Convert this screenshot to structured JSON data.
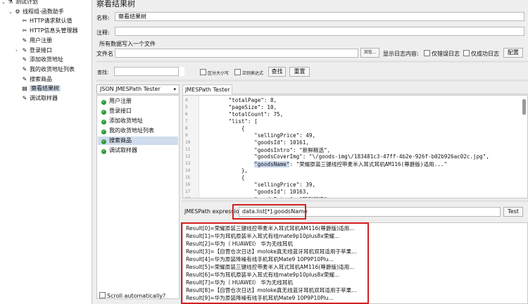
{
  "tree": {
    "items": [
      {
        "label": "测试计划",
        "icon": "⚗",
        "indent": 0,
        "arrow": "⌄"
      },
      {
        "label": "线程组-函数助手",
        "icon": "⚙",
        "indent": 1,
        "arrow": "⌄"
      },
      {
        "label": "HTTP请求默认值",
        "icon": "✂",
        "indent": 2,
        "arrow": ""
      },
      {
        "label": "HTTP信息头管理器",
        "icon": "✂",
        "indent": 2,
        "arrow": ""
      },
      {
        "label": "用户注册",
        "icon": "✎",
        "indent": 2,
        "arrow": ""
      },
      {
        "label": "登录接口",
        "icon": "✎",
        "indent": 2,
        "arrow": "›"
      },
      {
        "label": "添加收货地址",
        "icon": "✎",
        "indent": 2,
        "arrow": ""
      },
      {
        "label": "我的收货地址列表",
        "icon": "✎",
        "indent": 2,
        "arrow": ""
      },
      {
        "label": "搜索商品",
        "icon": "✎",
        "indent": 2,
        "arrow": ""
      },
      {
        "label": "察看结果树",
        "icon": "▤",
        "indent": 2,
        "arrow": "",
        "selected": true
      },
      {
        "label": "调试取样器",
        "icon": "✎",
        "indent": 2,
        "arrow": ""
      }
    ]
  },
  "panel": {
    "title": "察看结果树",
    "name_label": "名称:",
    "name_value": "察看结果树",
    "comment_label": "注释:",
    "comment_value": "",
    "write_all_label": "所有数据写入一个文件",
    "filename_label": "文件名",
    "filename_value": "",
    "browse_label": "浏览...",
    "log_content_label": "显示日志内容:",
    "errors_only_label": "仅错误日志",
    "success_only_label": "仅成功日志",
    "config_label": "配置",
    "search_label": "查找:",
    "search_value": "",
    "case_sensitive_label": "区分大小写",
    "regex_label": "正则表达式",
    "find_button": "查找",
    "reset_button": "重置"
  },
  "renderer": {
    "selected": "JSON JMESPath Tester"
  },
  "results": {
    "items": [
      {
        "label": "用户注册"
      },
      {
        "label": "登录接口"
      },
      {
        "label": "添加收货地址"
      },
      {
        "label": "我的收货地址列表"
      },
      {
        "label": "搜索商品",
        "selected": true
      },
      {
        "label": "调试取样器"
      }
    ],
    "scroll_auto_label": "Scroll automatically?"
  },
  "tester": {
    "tab_label": "JMESPath Tester",
    "lines": [
      {
        "n": "4",
        "text": "        \"totalPage\": 8,"
      },
      {
        "n": "5",
        "text": "        \"pageSize\": 10,"
      },
      {
        "n": "6",
        "text": "        \"totalCount\": 75,"
      },
      {
        "n": "7",
        "text": "        \"list\": ["
      },
      {
        "n": "8",
        "text": "            {"
      },
      {
        "n": "9",
        "text": "                \"sellingPrice\": 49,"
      },
      {
        "n": "10",
        "text": "                \"goodsId\": 10161,"
      },
      {
        "n": "11",
        "text": "                \"goodsIntro\": \"新鲜精选\","
      },
      {
        "n": "12",
        "text": "                \"goodsCoverImg\": \"\\/goods-img\\/183481c3-47ff-4b2e-926f-b02b926ac02c.jpg\","
      },
      {
        "n": "13",
        "pre": "                ",
        "hl": "\"goodsName\"",
        "post": ": \"荣耀原装三键线控带麦半入耳式耳机AM116(尊爵版)适用...\""
      },
      {
        "n": "14",
        "text": "            },"
      },
      {
        "n": "15",
        "text": "            {"
      },
      {
        "n": "16",
        "text": "                \"sellingPrice\": 39,"
      },
      {
        "n": "17",
        "text": "                \"goodsId\": 10163,"
      },
      {
        "n": "18",
        "text": "                \"goodsIntro\": \"新鲜精选\""
      }
    ],
    "expr_label": "JMESPath expression",
    "expr_value": "data.list[*].goodsName",
    "test_button": "Test",
    "result_lines": [
      "Result[0]=荣耀原装三键线控带麦半入耳式耳机AM116(尊爵版)适用...",
      "Result[1]=华为耳机原装半入耳式有线mate9p10plus8x荣耀...",
      "Result[2]=华为（ HUAWEI） 华为无线耳机",
      "Result[3]=【自营仓次日达】moloke真无线蓝牙耳机双耳适用于苹果...",
      "Result[4]=华为原装降噪有线手机耳机Mate9 10P9P10Plu...",
      "Result[5]=荣耀原装三键线控带麦半入耳式耳机AM116(尊爵版)适用...",
      "Result[6]=华为耳机原装半入耳式有线mate9p10plus8x荣耀...",
      "Result[7]=华为（ HUAWEI） 华为无线耳机",
      "Result[8]=【自营仓次日达】moloke真无线蓝牙耳机双耳适用于苹果...",
      "Result[9]=华为原装降噪有线手机耳机Mate9 10P9P10Plu..."
    ]
  },
  "colors": {
    "highlight_box": "#d42020",
    "ok_icon": "#2e9a3a",
    "selection": "#cfdcec"
  }
}
